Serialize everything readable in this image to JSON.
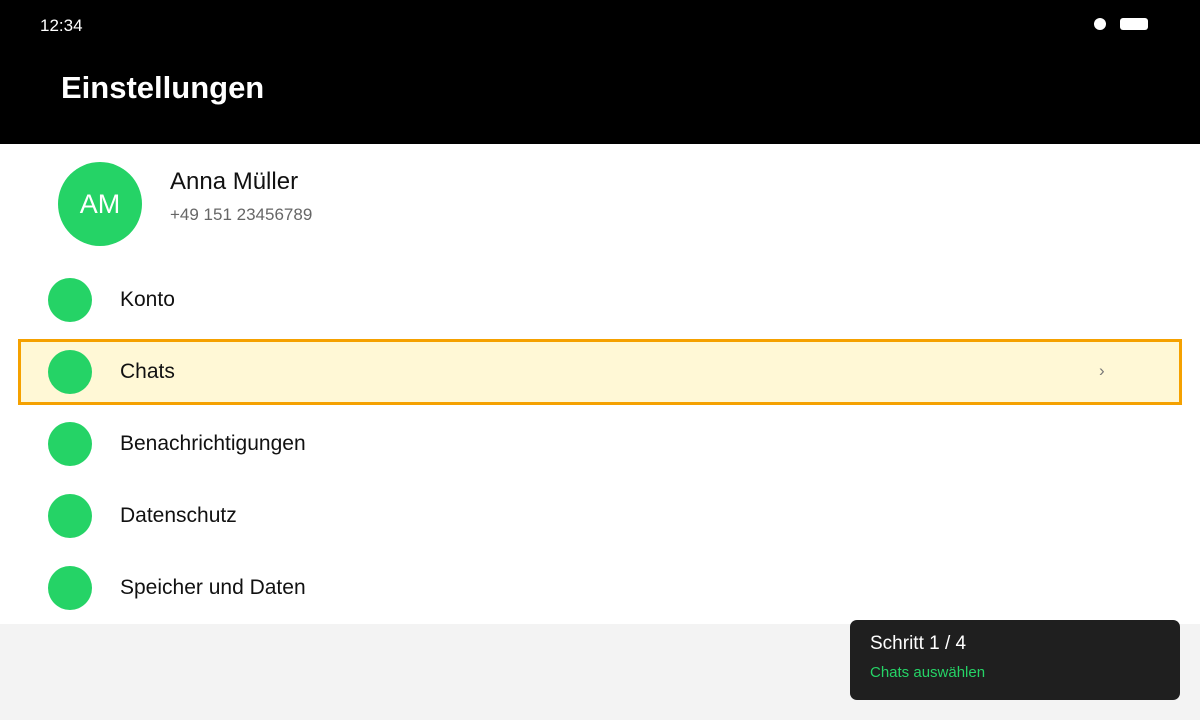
{
  "status_bar": {
    "time": "12:34"
  },
  "header": {
    "title": "Einstellungen"
  },
  "profile": {
    "initials": "AM",
    "name": "Anna Müller",
    "phone": "+49 151 23456789"
  },
  "menu": {
    "items": [
      {
        "label": "Konto",
        "icon": "account-icon"
      },
      {
        "label": "Chats",
        "icon": "chats-icon",
        "highlighted": true,
        "trailing": "›"
      },
      {
        "label": "Benachrichtigungen",
        "icon": "notifications-icon"
      },
      {
        "label": "Datenschutz",
        "icon": "privacy-icon"
      },
      {
        "label": "Speicher und Daten",
        "icon": "storage-icon"
      }
    ]
  },
  "tutorial": {
    "step": "Schritt 1 / 4",
    "hint": "Chats auswählen"
  },
  "colors": {
    "accent": "#25d366",
    "highlight_border": "#f5a100",
    "highlight_fill": "#fff8d6",
    "header_bg": "#000000"
  }
}
